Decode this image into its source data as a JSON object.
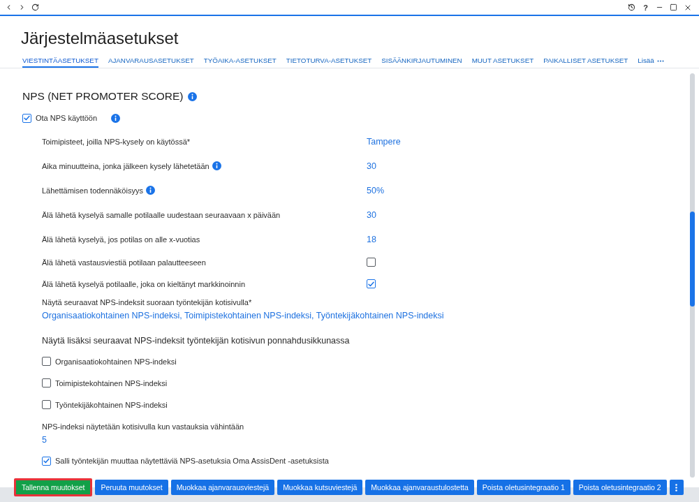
{
  "toolbar": {
    "help": "?"
  },
  "page": {
    "title": "Järjestelmäasetukset"
  },
  "tabs": [
    {
      "label": "VIESTINTÄASETUKSET",
      "selected": true
    },
    {
      "label": "AJANVARAUSASETUKSET",
      "selected": false
    },
    {
      "label": "TYÖAIKA-ASETUKSET",
      "selected": false
    },
    {
      "label": "TIETOTURVA-ASETUKSET",
      "selected": false
    },
    {
      "label": "SISÄÄNKIRJAUTUMINEN",
      "selected": false
    },
    {
      "label": "MUUT ASETUKSET",
      "selected": false
    },
    {
      "label": "PAIKALLISET ASETUKSET",
      "selected": false
    }
  ],
  "more_tab": {
    "label": "Lisää"
  },
  "section": {
    "title": "NPS (NET PROMOTER SCORE)",
    "info": true,
    "enable": {
      "label": "Ota NPS käyttöön",
      "checked": true,
      "info": true
    },
    "settings": [
      {
        "kind": "value",
        "label": "Toimipisteet, joilla NPS-kysely on käytössä*",
        "info": false,
        "value": "Tampere"
      },
      {
        "kind": "value",
        "label": "Aika minuutteina, jonka jälkeen kysely lähetetään",
        "info": true,
        "value": "30"
      },
      {
        "kind": "value",
        "label": "Lähettämisen todennäköisyys",
        "info": true,
        "value": "50%"
      },
      {
        "kind": "value",
        "label": "Älä lähetä kyselyä samalle potilaalle uudestaan seuraavaan x päivään",
        "info": false,
        "value": "30"
      },
      {
        "kind": "value",
        "label": "Älä lähetä kyselyä, jos potilas on alle x-vuotias",
        "info": false,
        "value": "18"
      },
      {
        "kind": "checkbox",
        "label": "Älä lähetä vastausviestiä potilaan palautteeseen",
        "info": false,
        "checked": false
      },
      {
        "kind": "checkbox",
        "label": "Älä lähetä kyselyä potilaalle, joka on kieltänyt markkinoinnin",
        "info": false,
        "checked": true
      }
    ],
    "homepage_indexes": {
      "label": "Näytä seuraavat NPS-indeksit suoraan työntekijän kotisivulla*",
      "value": "Organisaatiokohtainen NPS-indeksi, Toimipistekohtainen NPS-indeksi, Työntekijäkohtainen NPS-indeksi"
    },
    "popup_indexes": {
      "title": "Näytä lisäksi seuraavat NPS-indeksit työntekijän kotisivun ponnahdusikkunassa",
      "options": [
        {
          "label": "Organisaatiokohtainen NPS-indeksi",
          "checked": false
        },
        {
          "label": "Toimipistekohtainen NPS-indeksi",
          "checked": false
        },
        {
          "label": "Työntekijäkohtainen NPS-indeksi",
          "checked": false
        }
      ]
    },
    "min_responses": {
      "label": "NPS-indeksi näytetään kotisivulla kun vastauksia vähintään",
      "value": "5"
    },
    "allow_employee": {
      "label": "Salli työntekijän muuttaa näytettäviä NPS-asetuksia Oma AssisDent -asetuksista",
      "checked": true
    }
  },
  "footer_buttons": [
    {
      "label": "Tallenna muutokset",
      "kind": "save",
      "highlighted": true
    },
    {
      "label": "Peruuta muutokset",
      "kind": "action",
      "highlighted": false
    },
    {
      "label": "Muokkaa ajanvarausviestejä",
      "kind": "action",
      "highlighted": false
    },
    {
      "label": "Muokkaa kutsuviestejä",
      "kind": "action",
      "highlighted": false
    },
    {
      "label": "Muokkaa ajanvaraustulostetta",
      "kind": "action",
      "highlighted": false
    },
    {
      "label": "Poista oletusintegraatio 1",
      "kind": "action",
      "highlighted": false
    },
    {
      "label": "Poista oletusintegraatio 2",
      "kind": "action",
      "highlighted": false
    }
  ]
}
